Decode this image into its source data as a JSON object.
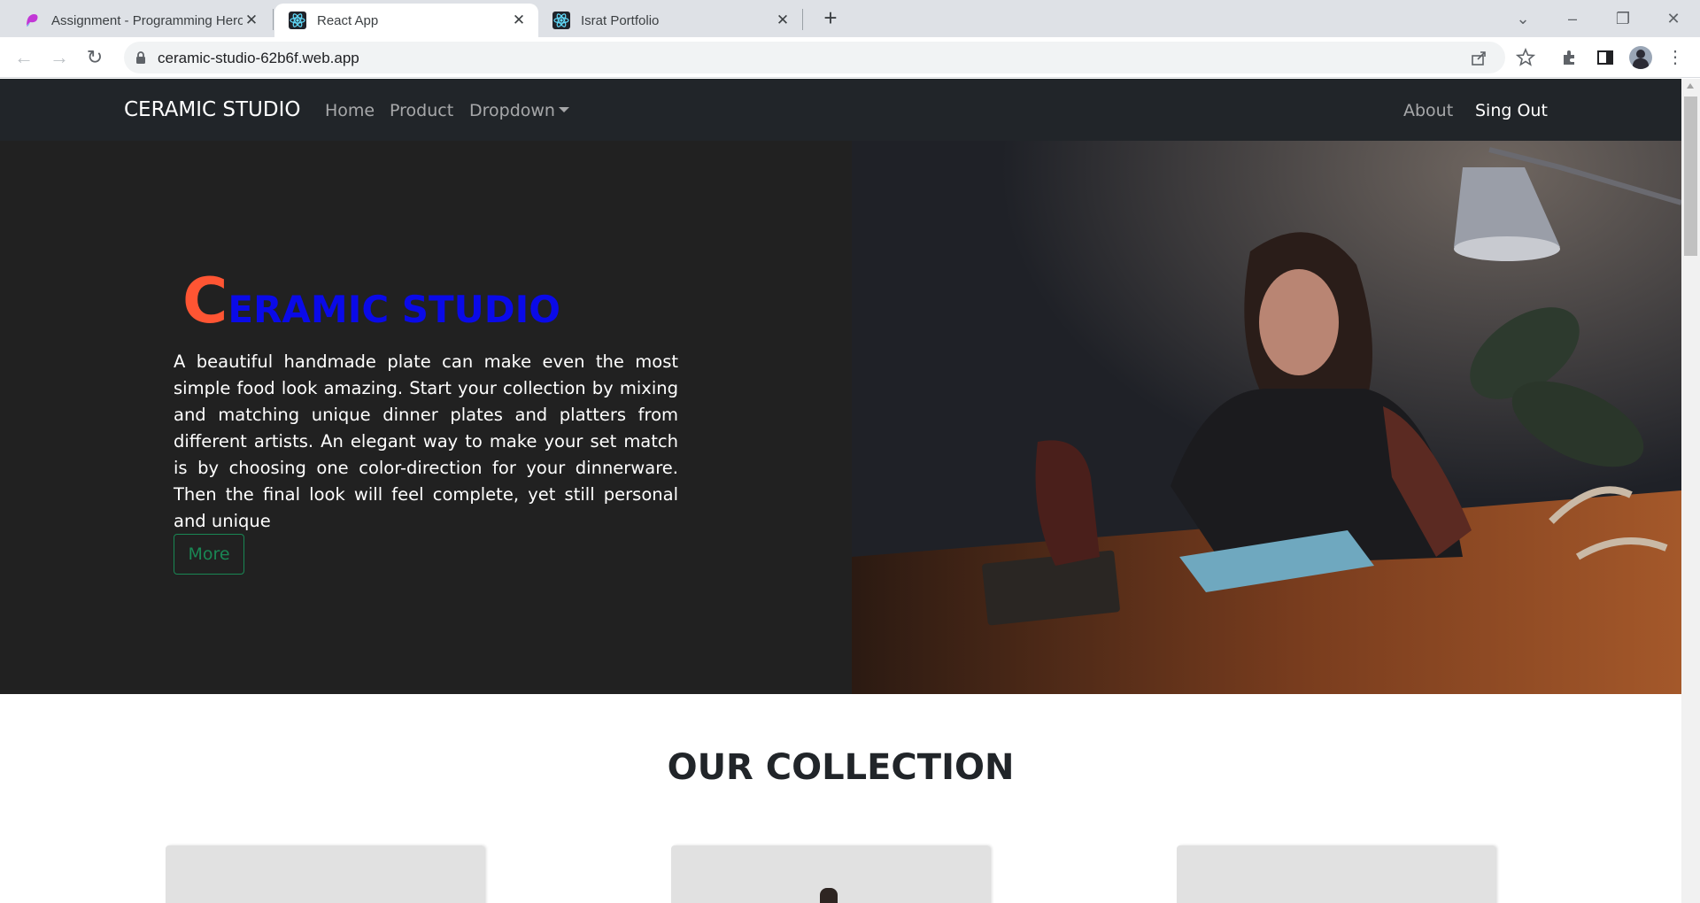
{
  "browser": {
    "tabs": [
      {
        "title": "Assignment - Programming Hero",
        "icon": "programming-hero-icon"
      },
      {
        "title": "React App",
        "icon": "react-icon"
      },
      {
        "title": "Israt Portfolio",
        "icon": "react-icon"
      }
    ],
    "url": "ceramic-studio-62b6f.web.app"
  },
  "navbar": {
    "brand": "CERAMIC STUDIO",
    "links": [
      "Home",
      "Product",
      "Dropdown"
    ],
    "right_links": [
      "About",
      "Sing Out"
    ]
  },
  "hero": {
    "title_initial": "C",
    "title_rest": "ERAMIC STUDIO",
    "description": "A beautiful handmade plate can make even the most simple food look amazing. Start your collection by mixing and matching unique dinner plates and platters from different artists. An elegant way to make your set match is by choosing one color-direction for your dinnerware. Then the final look will feel complete, yet still personal and unique",
    "button": "More",
    "colors": {
      "initial": "#ff5533",
      "rest": "#0a0ae8",
      "button": "#198754"
    }
  },
  "collection": {
    "title": "OUR COLLECTION"
  }
}
